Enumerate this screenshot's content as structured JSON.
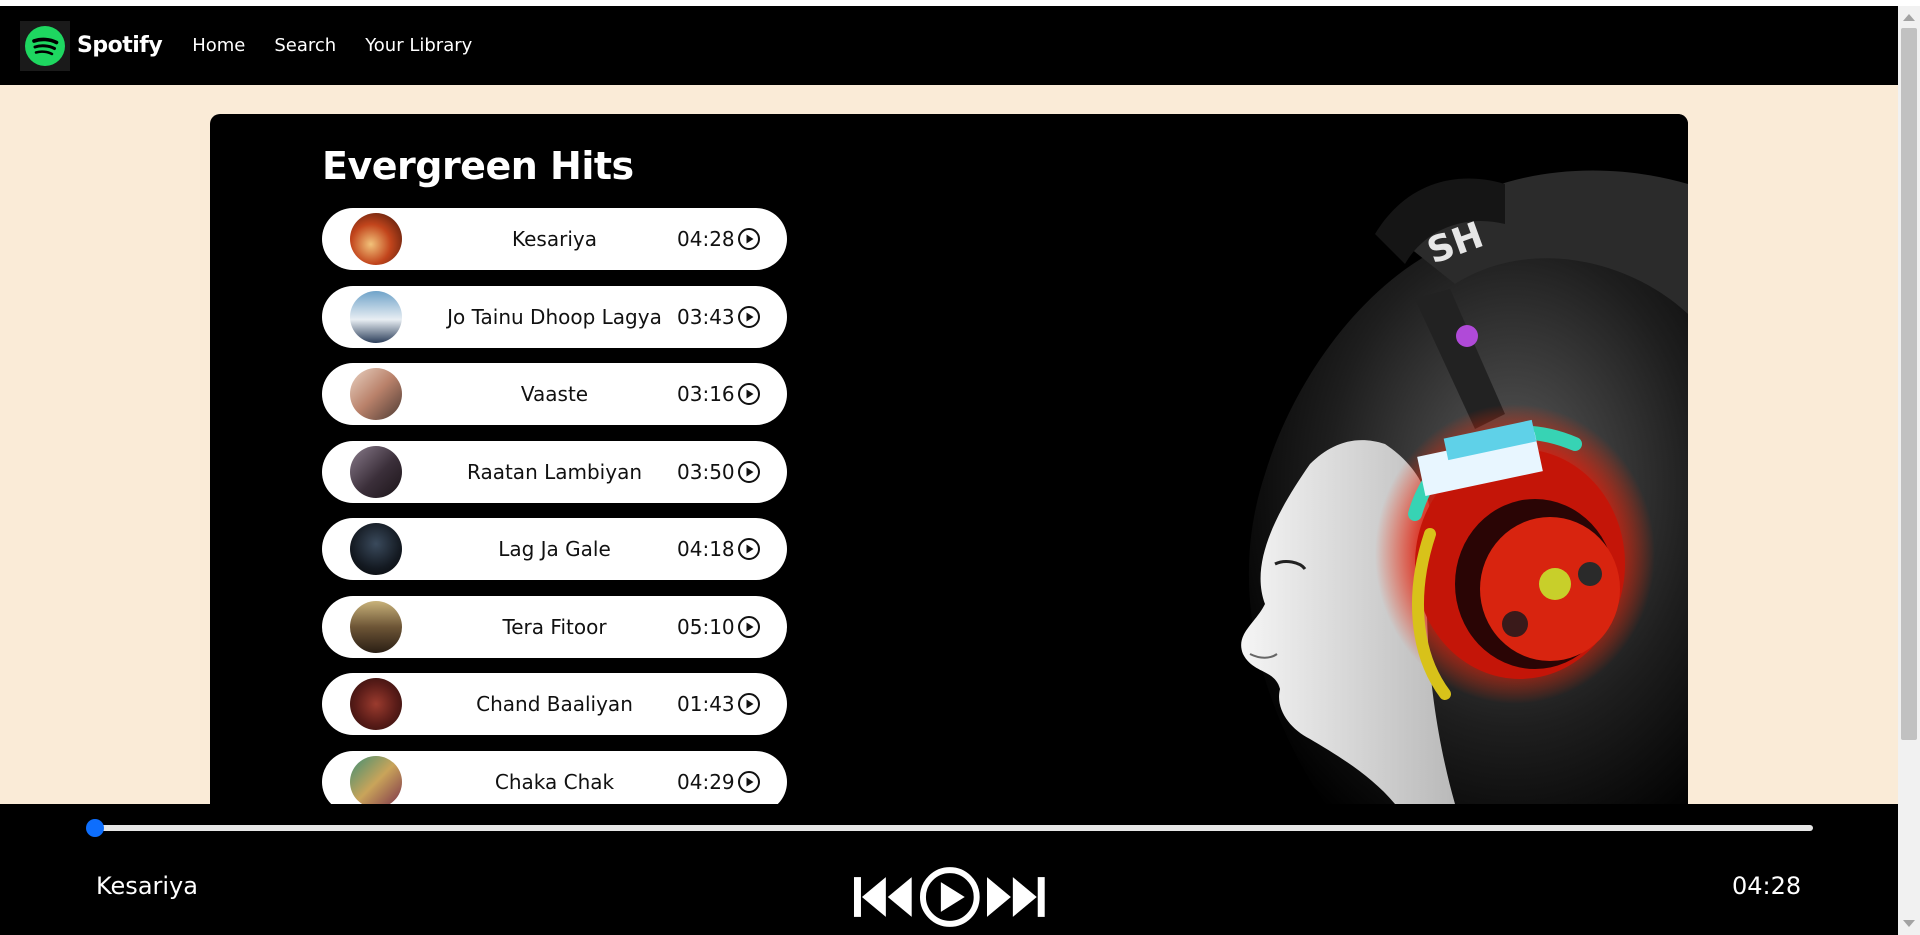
{
  "brand": {
    "name": "Spotify",
    "color": "#1ed760",
    "icon": "spotify-logo-icon"
  },
  "nav": {
    "items": [
      "Home",
      "Search",
      "Your Library"
    ]
  },
  "playlist": {
    "title": "Evergreen Hits",
    "songs": [
      {
        "name": "Kesariya",
        "duration": "04:28",
        "icon": "play-circle-icon"
      },
      {
        "name": "Jo Tainu Dhoop Lagya",
        "duration": "03:43",
        "icon": "play-circle-icon"
      },
      {
        "name": "Vaaste",
        "duration": "03:16",
        "icon": "play-circle-icon"
      },
      {
        "name": "Raatan Lambiyan",
        "duration": "03:50",
        "icon": "play-circle-icon"
      },
      {
        "name": "Lag Ja Gale",
        "duration": "04:18",
        "icon": "play-circle-icon"
      },
      {
        "name": "Tera Fitoor",
        "duration": "05:10",
        "icon": "play-circle-icon"
      },
      {
        "name": "Chand Baaliyan",
        "duration": "01:43",
        "icon": "play-circle-icon"
      },
      {
        "name": "Chaka Chak",
        "duration": "04:29",
        "icon": "play-circle-icon"
      }
    ]
  },
  "player": {
    "current_song": "Kesariya",
    "duration": "04:28",
    "progress": 0,
    "accent": "#0d6efd",
    "controls": [
      "skip-back-icon",
      "play-circle-icon",
      "skip-forward-icon"
    ]
  },
  "colors": {
    "page_bg": "#faebd7",
    "panel_bg": "#000000",
    "row_bg": "#ffffff"
  }
}
